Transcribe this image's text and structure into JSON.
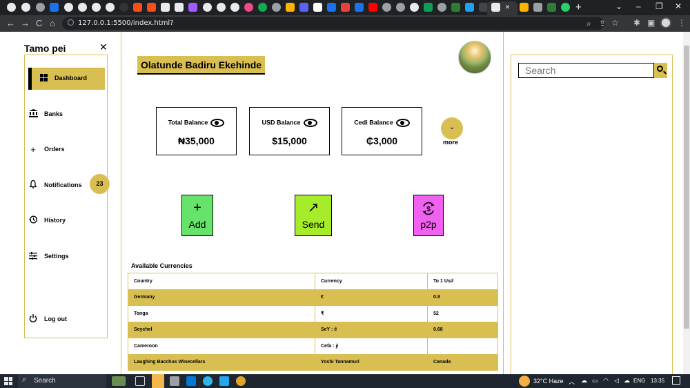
{
  "browser": {
    "url": "127.0.0.1:5500/index.html?",
    "tab_close": "×",
    "new_tab": "+",
    "window_controls": [
      "⌄",
      "–",
      "❐",
      "✕"
    ],
    "nav_buttons": [
      "←",
      "→",
      "C",
      "⌂"
    ]
  },
  "sidebar": {
    "brand": "Tamo pei",
    "close": "✕",
    "items": [
      {
        "label": "Dashboard",
        "icon": "grid-icon"
      },
      {
        "label": "Banks",
        "icon": "bank-icon"
      },
      {
        "label": "Orders",
        "icon": "plus-icon"
      },
      {
        "label": "Notifications",
        "icon": "bell-icon",
        "badge": "23"
      },
      {
        "label": "History",
        "icon": "history-icon"
      },
      {
        "label": "Settings",
        "icon": "sliders-icon"
      },
      {
        "label": "Log out",
        "icon": "power-icon"
      }
    ]
  },
  "header": {
    "username": "Olatunde Badiru Ekehinde"
  },
  "balances": [
    {
      "title": "Total Balance",
      "value": "₦35,000"
    },
    {
      "title": "USD Balance",
      "value": "$15,000"
    },
    {
      "title": "Cedi Balance",
      "value": "₵3,000"
    }
  ],
  "more": {
    "icon": "⌄",
    "label": "more"
  },
  "actions": [
    {
      "label": "Add",
      "icon": "+",
      "color": "#66e36a"
    },
    {
      "label": "Send",
      "icon": "↗",
      "color": "#a6ec2a"
    },
    {
      "label": "p2p",
      "icon": "$",
      "color": "#f061f0"
    }
  ],
  "currencies": {
    "title": "Available Currencies",
    "headers": [
      "Country",
      "Currency",
      "To 1 Usd"
    ],
    "rows": [
      [
        "Germany",
        "€",
        "0.8"
      ],
      [
        "Tonga",
        "₹",
        "52"
      ],
      [
        "Seychel",
        "SeY : ê",
        "0.68"
      ],
      [
        "Cameroon",
        "Cefa : ∮",
        ""
      ],
      [
        "Laughing Bacchus Winecellars",
        "Yoshi Tannamuri",
        "Canada"
      ]
    ]
  },
  "search": {
    "placeholder": "Search"
  },
  "taskbar": {
    "search_label": "Search",
    "weather": "32°C  Haze",
    "language": "ENG",
    "time": "13:35"
  },
  "colors": {
    "accent": "#d9bf52",
    "chrome_dark": "#202124",
    "taskbar": "#1f2630"
  }
}
